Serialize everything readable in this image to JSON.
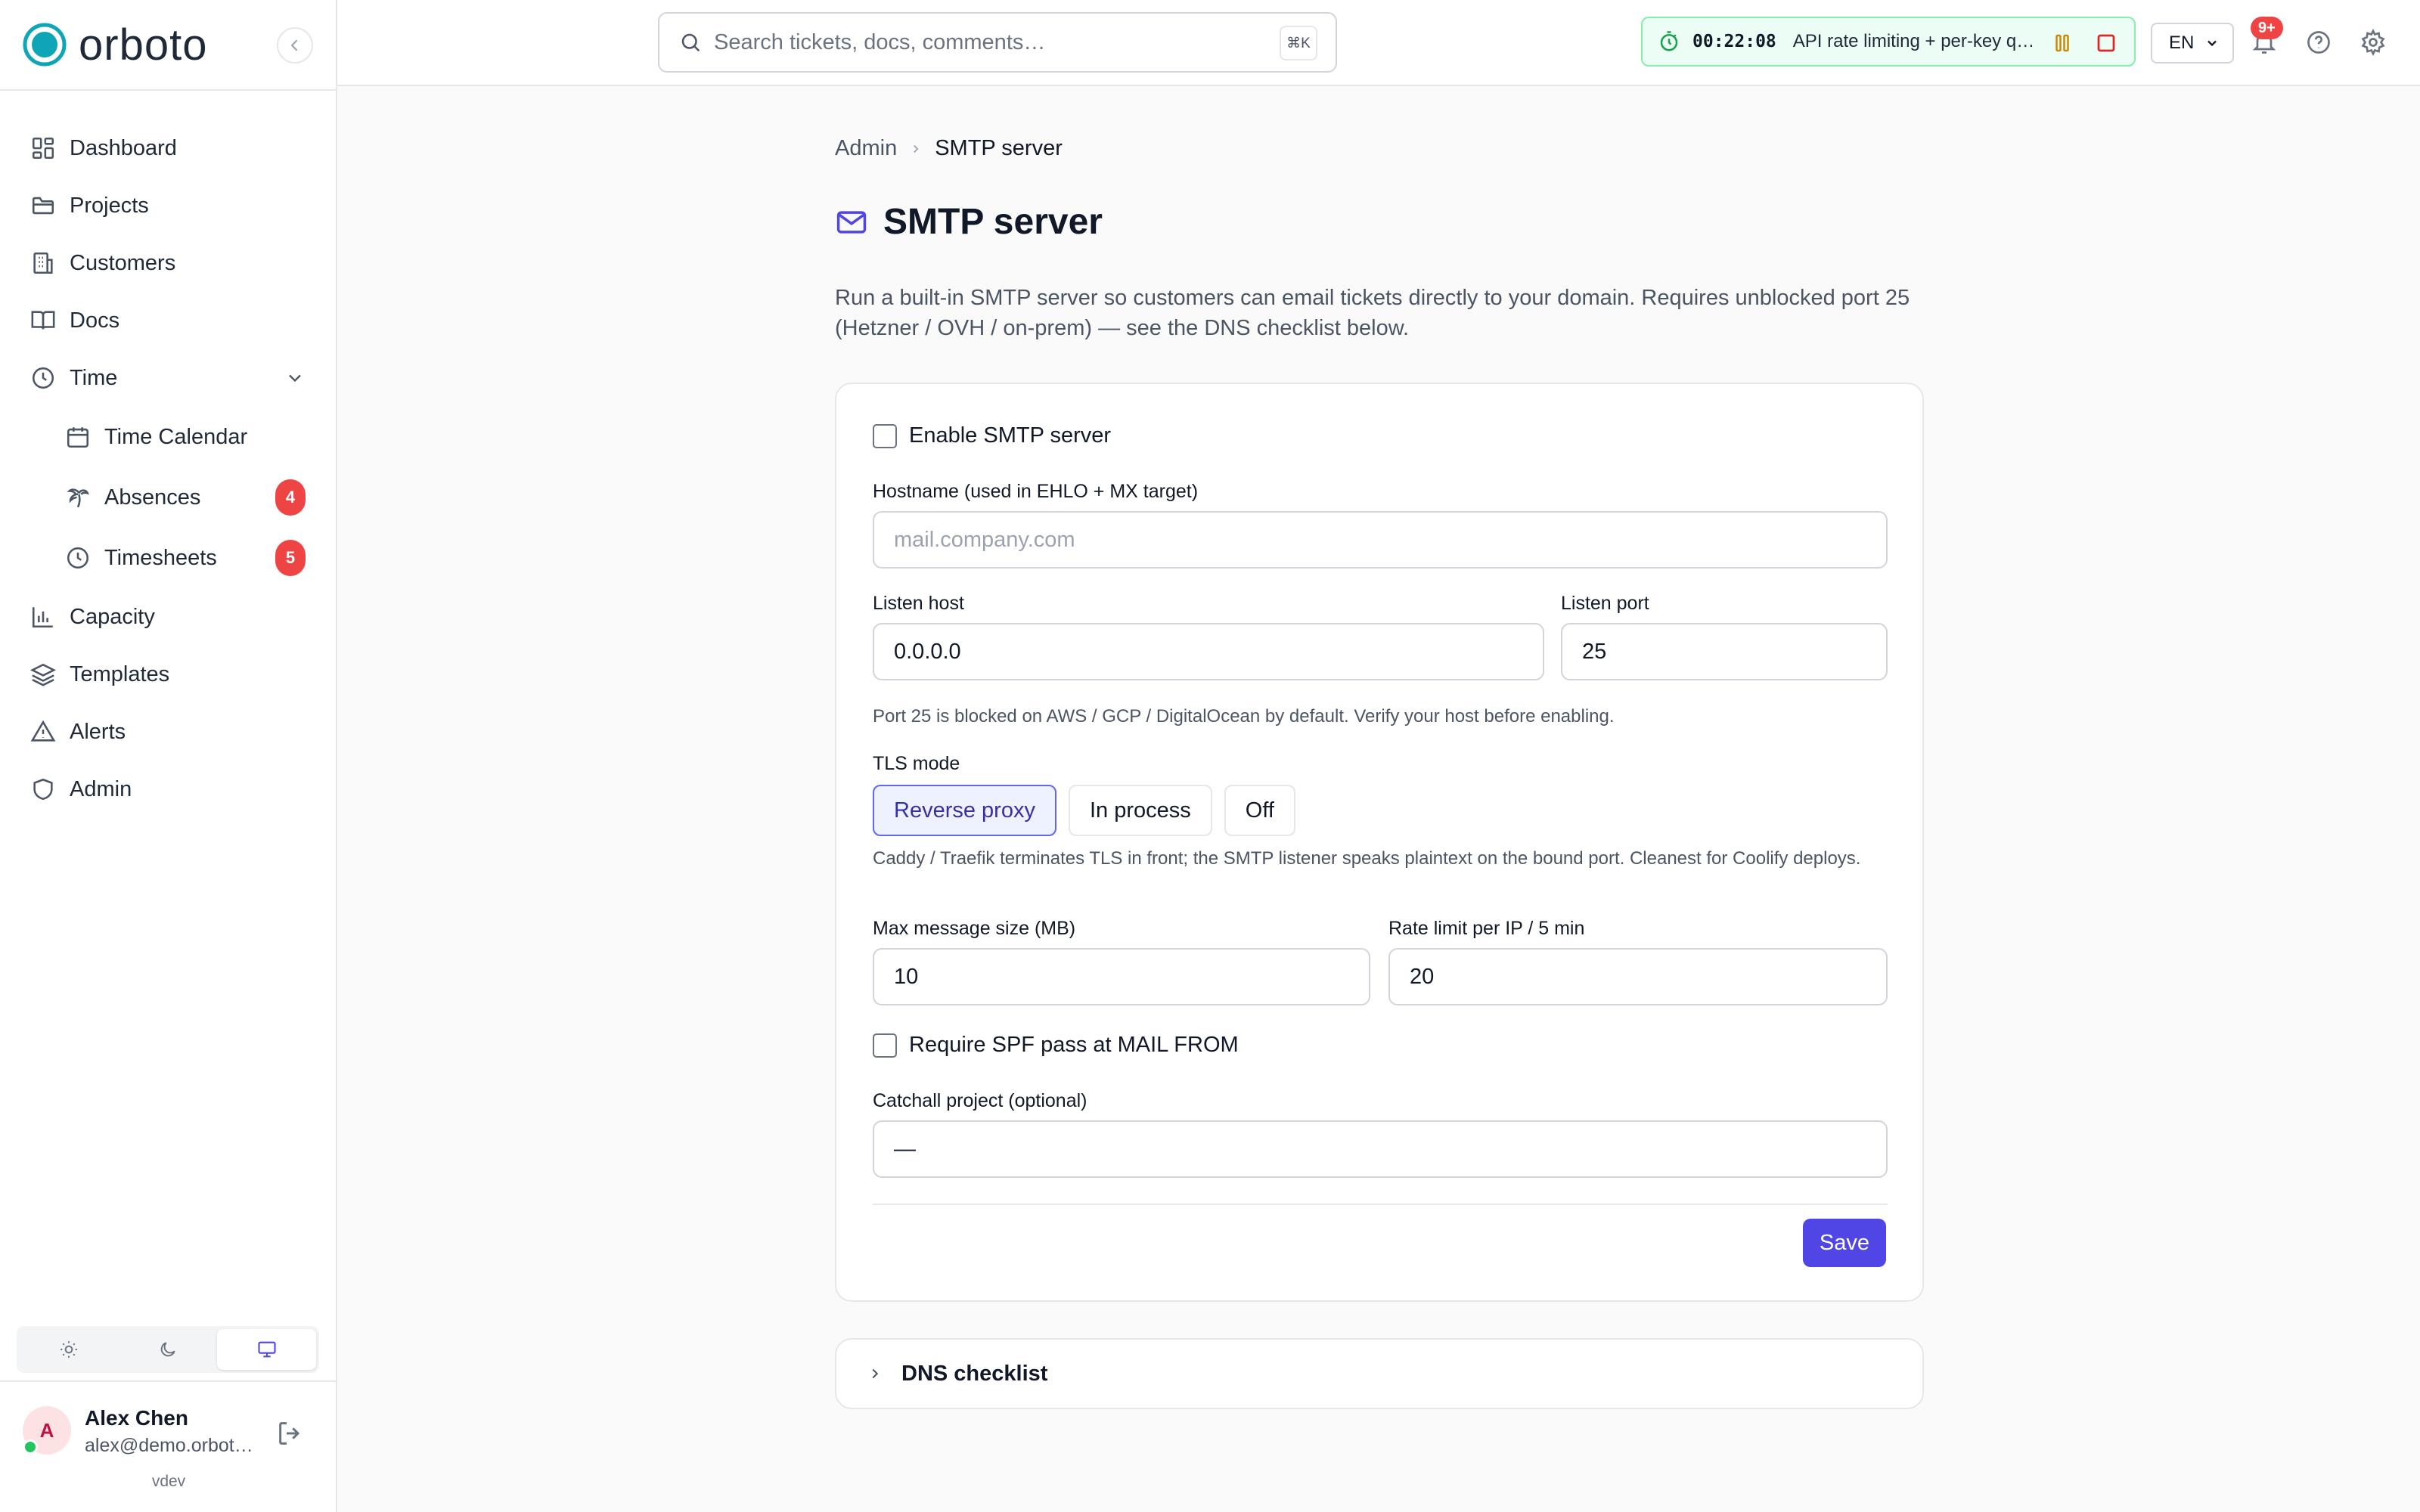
{
  "app": {
    "name": "orboto",
    "version": "vdev"
  },
  "sidebar": {
    "items": [
      {
        "label": "Dashboard",
        "icon": "dashboard-icon"
      },
      {
        "label": "Projects",
        "icon": "folder-icon"
      },
      {
        "label": "Customers",
        "icon": "building-icon"
      },
      {
        "label": "Docs",
        "icon": "book-icon"
      },
      {
        "label": "Time",
        "icon": "clock-icon",
        "expanded": true
      },
      {
        "label": "Time Calendar",
        "icon": "calendar-icon"
      },
      {
        "label": "Absences",
        "icon": "palm-tree-icon",
        "badge": "4"
      },
      {
        "label": "Timesheets",
        "icon": "clock-icon",
        "badge": "5"
      },
      {
        "label": "Capacity",
        "icon": "bar-chart-icon"
      },
      {
        "label": "Templates",
        "icon": "layers-icon"
      },
      {
        "label": "Alerts",
        "icon": "alert-triangle-icon"
      },
      {
        "label": "Admin",
        "icon": "shield-icon"
      }
    ],
    "theme": {
      "options": [
        "light",
        "dark",
        "system"
      ],
      "selected": "system"
    },
    "user": {
      "initial": "A",
      "name": "Alex Chen",
      "email": "alex@demo.orboto.com",
      "status": "online"
    }
  },
  "topbar": {
    "search": {
      "placeholder": "Search tickets, docs, comments…",
      "shortcut": "⌘K"
    },
    "timer": {
      "time": "00:22:08",
      "task": "API rate limiting + per-key quotas"
    },
    "language": "EN",
    "notifications_badge": "9+"
  },
  "page": {
    "breadcrumb": {
      "parent": "Admin",
      "current": "SMTP server"
    },
    "title": "SMTP server",
    "description": "Run a built-in SMTP server so customers can email tickets directly to your domain. Requires unblocked port 25 (Hetzner / OVH / on-prem) — see the DNS checklist below."
  },
  "form": {
    "enable": {
      "label": "Enable SMTP server",
      "checked": false
    },
    "hostname": {
      "label": "Hostname (used in EHLO + MX target)",
      "placeholder": "mail.company.com",
      "value": ""
    },
    "listen_host": {
      "label": "Listen host",
      "value": "0.0.0.0"
    },
    "listen_port": {
      "label": "Listen port",
      "value": "25"
    },
    "port_hint": "Port 25 is blocked on AWS / GCP / DigitalOcean by default. Verify your host before enabling.",
    "tls": {
      "label": "TLS mode",
      "options": [
        "Reverse proxy",
        "In process",
        "Off"
      ],
      "selected": "Reverse proxy",
      "hint": "Caddy / Traefik terminates TLS in front; the SMTP listener speaks plaintext on the bound port. Cleanest for Coolify deploys."
    },
    "max_size": {
      "label": "Max message size (MB)",
      "value": "10"
    },
    "rate_limit": {
      "label": "Rate limit per IP / 5 min",
      "value": "20"
    },
    "require_spf": {
      "label": "Require SPF pass at MAIL FROM",
      "checked": false
    },
    "catchall": {
      "label": "Catchall project (optional)",
      "value": "—"
    },
    "save_label": "Save"
  },
  "dns": {
    "title": "DNS checklist",
    "expanded": false
  },
  "colors": {
    "accent": "#4f46e5",
    "brand": "#0ea5b7",
    "badge": "#ef4444",
    "timer_bg": "#ecfdf5"
  }
}
